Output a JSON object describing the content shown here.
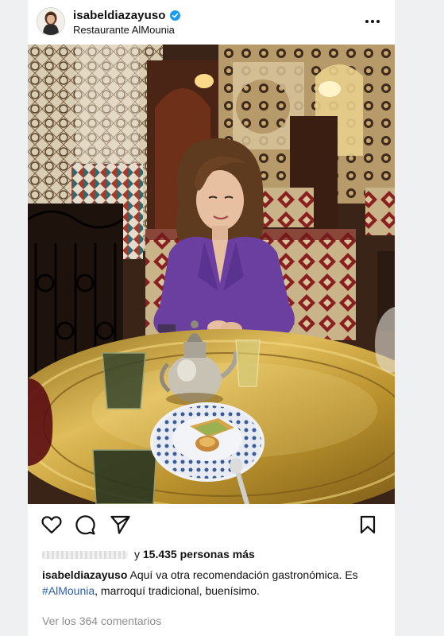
{
  "post": {
    "username": "isabeldiazayuso",
    "location": "Restaurante AlMounia",
    "verified_icon": "verified-badge-icon",
    "more_icon": "more-options-icon"
  },
  "actions": {
    "like_icon": "heart-icon",
    "comment_icon": "comment-icon",
    "share_icon": "send-icon",
    "save_icon": "bookmark-icon"
  },
  "likes": {
    "prefix": "y ",
    "count": "15.435",
    "suffix": " personas más"
  },
  "caption": {
    "username": "isabeldiazayuso",
    "text_before": " Aquí va otra recomendación gastronómica. Es ",
    "hashtag": "#AlMounia",
    "text_after": ", marroquí tradicional, buenísimo."
  },
  "comments_link": "Ver los 364 comentarios",
  "colors": {
    "verified": "#1d9bf0",
    "hashtag": "#2c5ea8",
    "muted": "#8e8e8e",
    "suit": "#6b3fa0"
  }
}
